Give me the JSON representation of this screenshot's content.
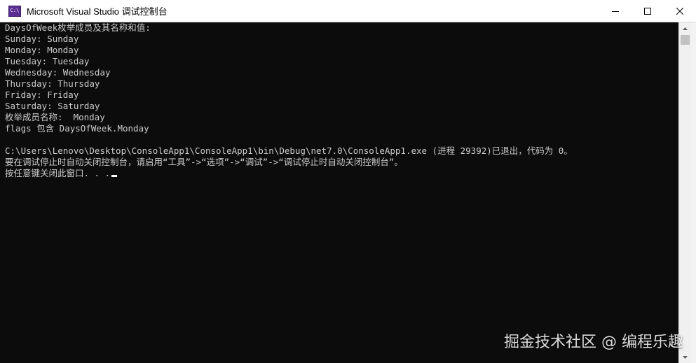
{
  "window": {
    "title": "Microsoft Visual Studio 调试控制台",
    "icon": "console-app-icon",
    "icon_text": "C:\\"
  },
  "controls": {
    "minimize": "minimize-icon",
    "maximize": "maximize-icon",
    "close": "close-icon"
  },
  "console": {
    "lines": [
      "DaysOfWeek枚举成员及其名称和值:",
      "Sunday: Sunday",
      "Monday: Monday",
      "Tuesday: Tuesday",
      "Wednesday: Wednesday",
      "Thursday: Thursday",
      "Friday: Friday",
      "Saturday: Saturday",
      "枚举成员名称:  Monday",
      "flags 包含 DaysOfWeek.Monday",
      "",
      "C:\\Users\\Lenovo\\Desktop\\ConsoleApp1\\ConsoleApp1\\bin\\Debug\\net7.0\\ConsoleApp1.exe (进程 29392)已退出，代码为 0。",
      "要在调试停止时自动关闭控制台，请启用“工具”->“选项”->“调试”->“调试停止时自动关闭控制台”。",
      "按任意键关闭此窗口. . ."
    ],
    "text_color": "#cccccc",
    "background": "#0c0c0c"
  },
  "watermark": {
    "text": "掘金技术社区 @ 编程乐趣"
  }
}
